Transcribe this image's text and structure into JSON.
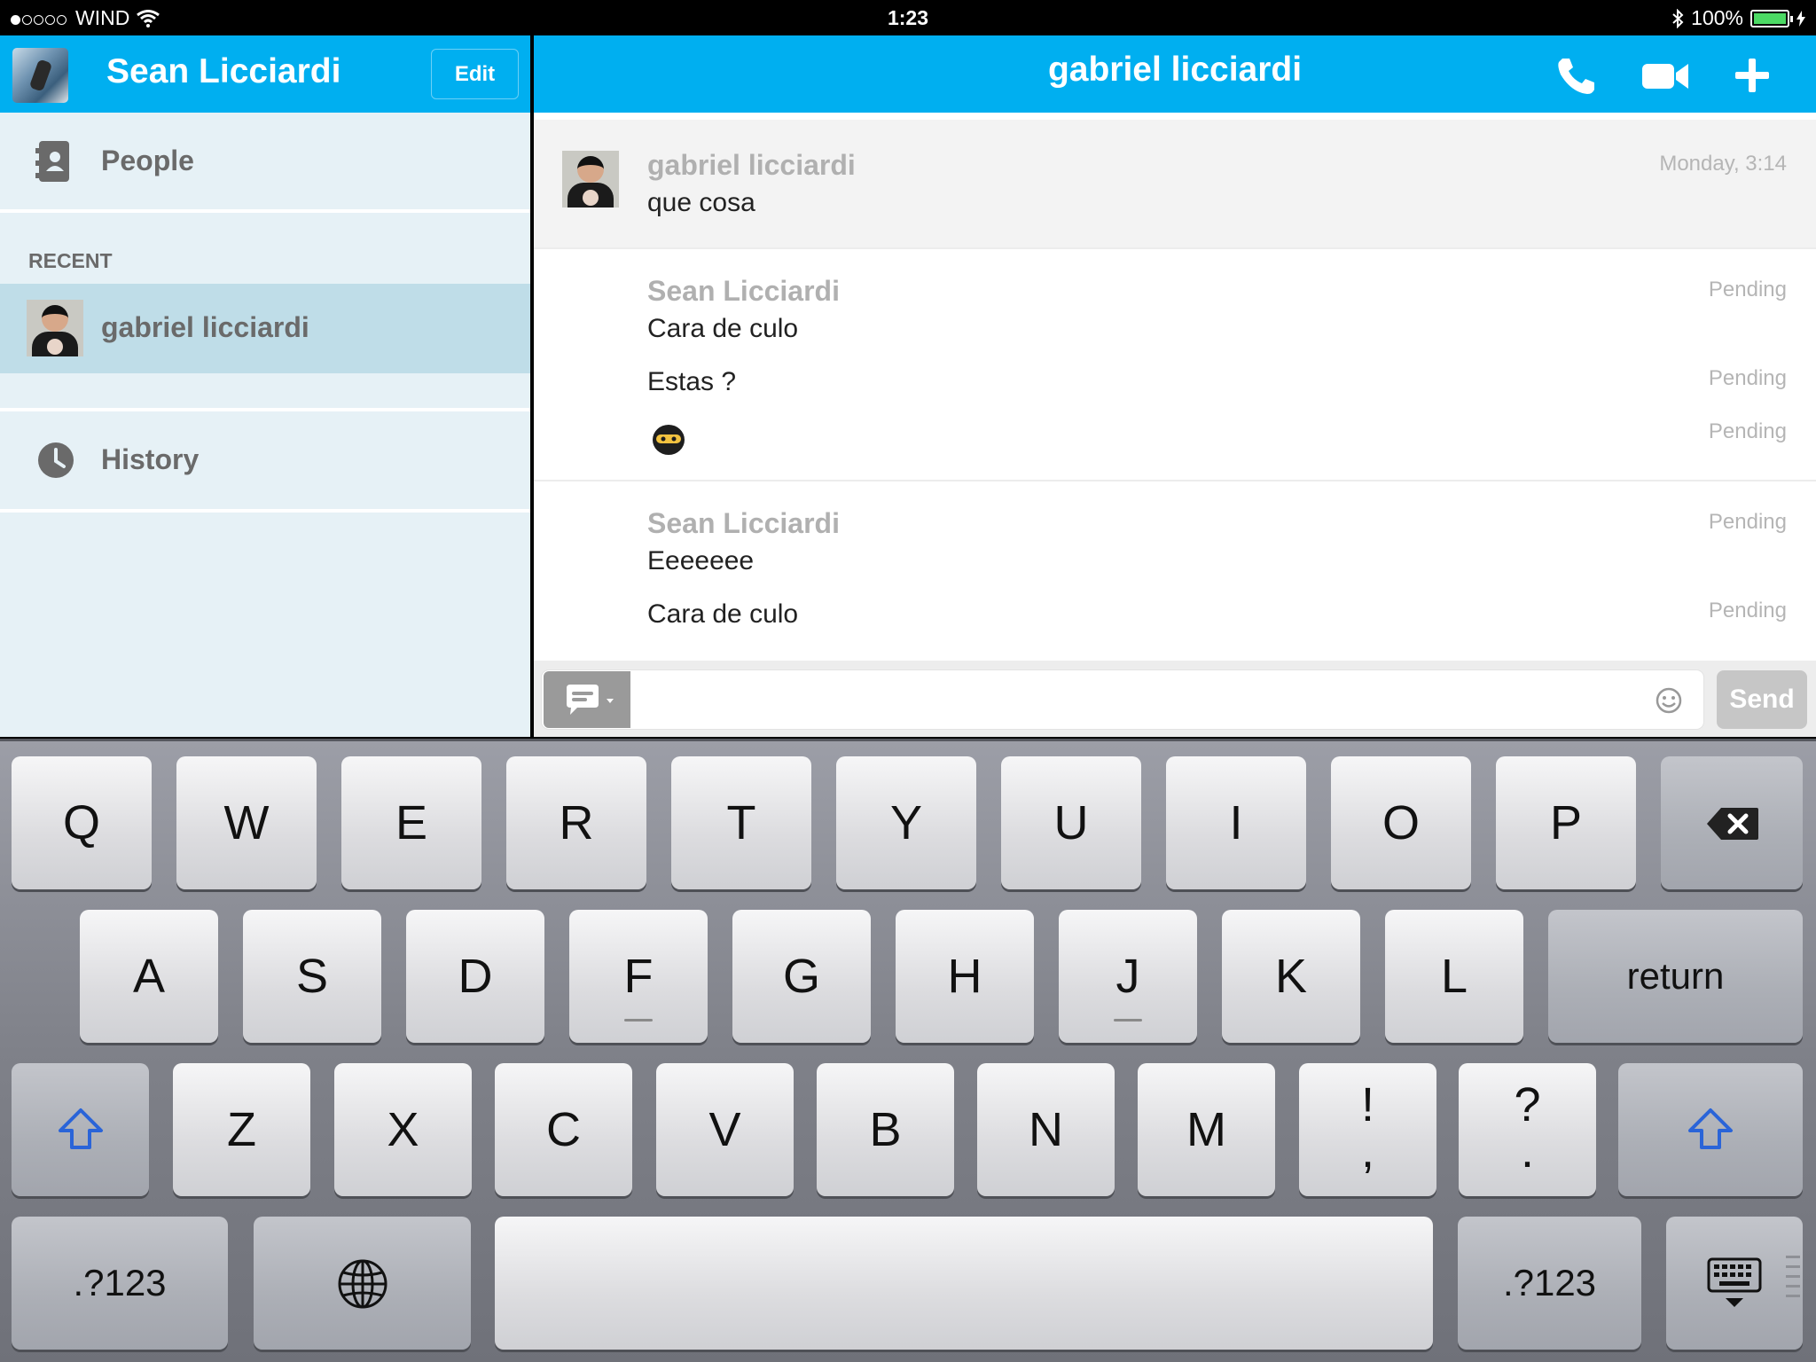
{
  "status_bar": {
    "carrier": "WIND",
    "time": "1:23",
    "battery": "100%",
    "signal_bars": 1,
    "battery_color": "#4cd964"
  },
  "sidebar": {
    "user_name": "Sean Licciardi",
    "edit_label": "Edit",
    "people_label": "People",
    "recent_heading": "RECENT",
    "recent_items": [
      {
        "name": "gabriel licciardi"
      }
    ],
    "history_label": "History"
  },
  "chat": {
    "title": "gabriel licciardi",
    "messages": [
      {
        "sender": "gabriel licciardi",
        "time": "Monday, 3:14",
        "lines": [
          "que cosa"
        ]
      },
      {
        "sender": "Sean Licciardi",
        "time": "Pending",
        "lines": [
          "Cara de culo",
          "Estas ?"
        ],
        "line_times": [
          "Pending"
        ],
        "emoji_time": "Pending"
      },
      {
        "sender": "Sean Licciardi",
        "time": "Pending",
        "lines": [
          "Eeeeeee",
          "Cara de culo"
        ],
        "line_times": [
          "Pending"
        ]
      }
    ],
    "input": {
      "value": "",
      "placeholder": ""
    },
    "send_label": "Send"
  },
  "keyboard": {
    "row1": [
      "Q",
      "W",
      "E",
      "R",
      "T",
      "Y",
      "U",
      "I",
      "O",
      "P"
    ],
    "row2": [
      "A",
      "S",
      "D",
      "F",
      "G",
      "H",
      "J",
      "K",
      "L"
    ],
    "return_label": "return",
    "row3": [
      "Z",
      "X",
      "C",
      "V",
      "B",
      "N",
      "M"
    ],
    "punct1": {
      "top": "!",
      "bottom": ","
    },
    "punct2": {
      "top": "?",
      "bottom": "."
    },
    "numbers_label": ".?123"
  },
  "colors": {
    "accent": "#00aff0",
    "sidebar_bg": "#e6f1f6",
    "selected_row": "#bfdde8",
    "shift_blue": "#2a64d8"
  },
  "icons": [
    "wifi-icon",
    "bluetooth-icon",
    "people-icon",
    "history-clock-icon",
    "phone-icon",
    "video-icon",
    "plus-icon",
    "chat-bubble-icon",
    "smiley-icon",
    "backspace-icon",
    "shift-icon",
    "globe-icon",
    "hide-keyboard-icon"
  ]
}
